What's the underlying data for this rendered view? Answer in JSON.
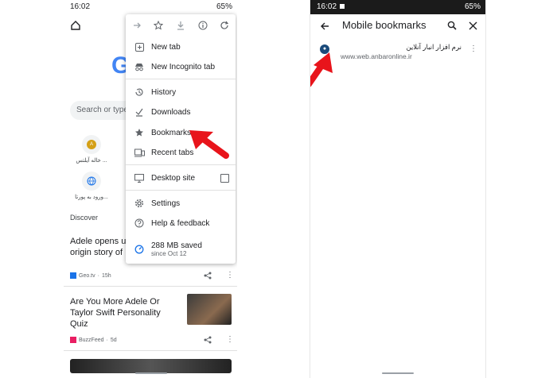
{
  "left": {
    "status_time": "16:02",
    "status_battery": "65%",
    "search_placeholder": "Search or type",
    "tiles": [
      {
        "label": "خاله آیلتس ..."
      },
      {
        "label": "ورود به پورتا..."
      }
    ],
    "discover_label": "Discover",
    "cards": [
      {
        "title_line1": "Adele opens up",
        "title_line2": "origin story of",
        "source": "Geo.tv",
        "age": "15h"
      },
      {
        "title_line1": "Are You More Adele Or",
        "title_line2": "Taylor Swift Personality",
        "title_line3": "Quiz",
        "source": "BuzzFeed",
        "age": "5d"
      }
    ],
    "tile_avatar_letter": "A"
  },
  "menu": {
    "items": {
      "new_tab": "New tab",
      "incognito": "New Incognito tab",
      "history": "History",
      "downloads": "Downloads",
      "bookmarks": "Bookmarks",
      "recent_tabs": "Recent tabs",
      "desktop_site": "Desktop site",
      "settings": "Settings",
      "help": "Help & feedback",
      "saved": "288 MB saved",
      "saved_since": "since Oct 12"
    }
  },
  "right": {
    "status_time": "16:02",
    "status_battery": "65%",
    "title": "Mobile bookmarks",
    "bookmark": {
      "title": "نرم افزار انبار آنلاین",
      "url": "www.web.anbaronline.ir"
    }
  },
  "colors": {
    "accent_red": "#e8141b",
    "google_blue": "#4285f4"
  }
}
